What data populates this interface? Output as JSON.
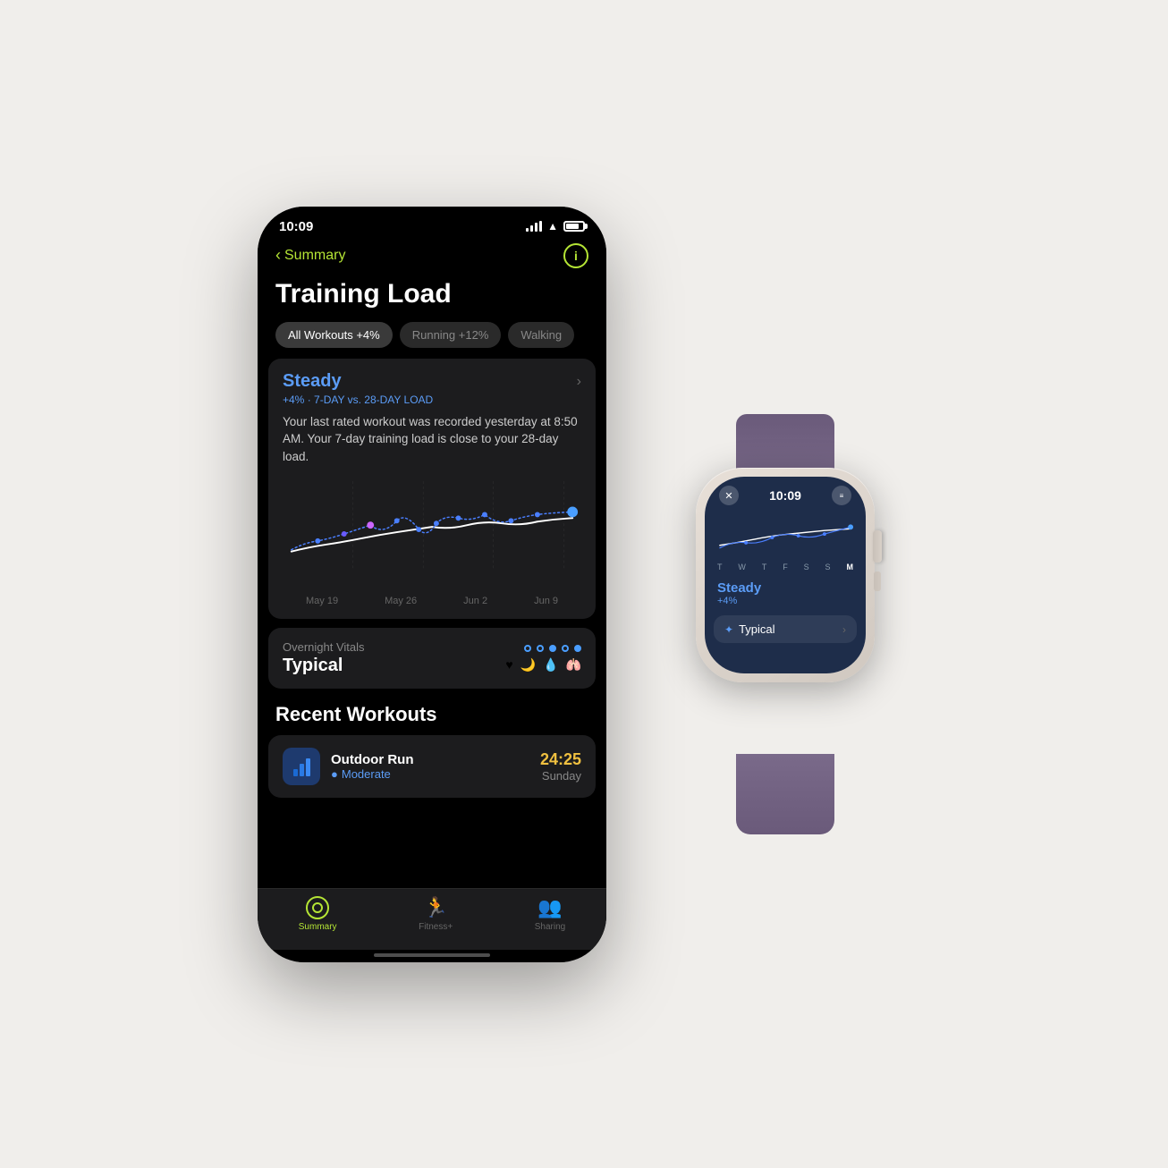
{
  "status_bar": {
    "time": "10:09"
  },
  "nav": {
    "back_label": "Summary",
    "info_icon": "ⓘ"
  },
  "page": {
    "title": "Training Load"
  },
  "filters": [
    {
      "label": "All Workouts +4%",
      "active": true
    },
    {
      "label": "Running +12%",
      "active": false
    },
    {
      "label": "Walking",
      "active": false
    }
  ],
  "training_card": {
    "status": "Steady",
    "percent": "+4%",
    "period": "7-DAY vs. 28-DAY LOAD",
    "description": "Your last rated workout was recorded yesterday at 8:50 AM. Your 7-day training load is close to your 28-day load.",
    "chart_labels": [
      "May 19",
      "May 26",
      "Jun 2",
      "Jun 9"
    ]
  },
  "vitals_card": {
    "label": "Overnight Vitals",
    "status": "Typical"
  },
  "recent_workouts": {
    "title": "Recent Workouts",
    "items": [
      {
        "name": "Outdoor Run",
        "intensity": "Moderate",
        "duration": "24:25",
        "day": "Sunday"
      }
    ]
  },
  "tab_bar": {
    "tabs": [
      {
        "label": "Summary",
        "active": true
      },
      {
        "label": "Fitness+",
        "active": false
      },
      {
        "label": "Sharing",
        "active": false
      }
    ]
  },
  "watch": {
    "time": "10:09",
    "steady_title": "Steady",
    "steady_sub": "+4%",
    "typical_label": "Typical",
    "day_labels": [
      "T",
      "W",
      "T",
      "F",
      "S",
      "S",
      "M"
    ],
    "close_icon": "✕",
    "menu_icon": "≡"
  }
}
